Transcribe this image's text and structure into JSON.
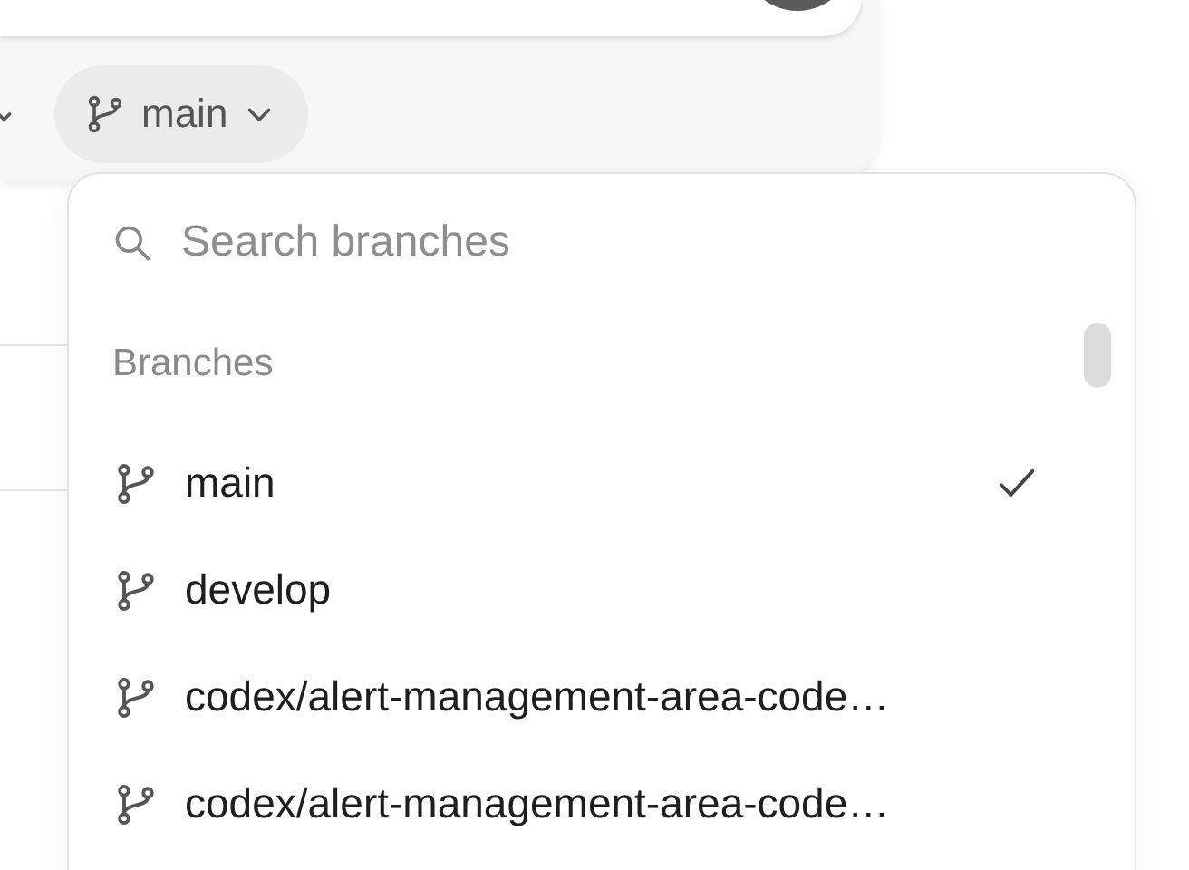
{
  "composer": {
    "branch_button": {
      "label": "main"
    }
  },
  "branch_menu": {
    "search": {
      "placeholder": "Search branches"
    },
    "section_title": "Branches",
    "items": [
      {
        "label": "main",
        "selected": true
      },
      {
        "label": "develop",
        "selected": false
      },
      {
        "label": "codex/alert-management-area-code…",
        "selected": false
      },
      {
        "label": "codex/alert-management-area-code…",
        "selected": false
      }
    ]
  }
}
